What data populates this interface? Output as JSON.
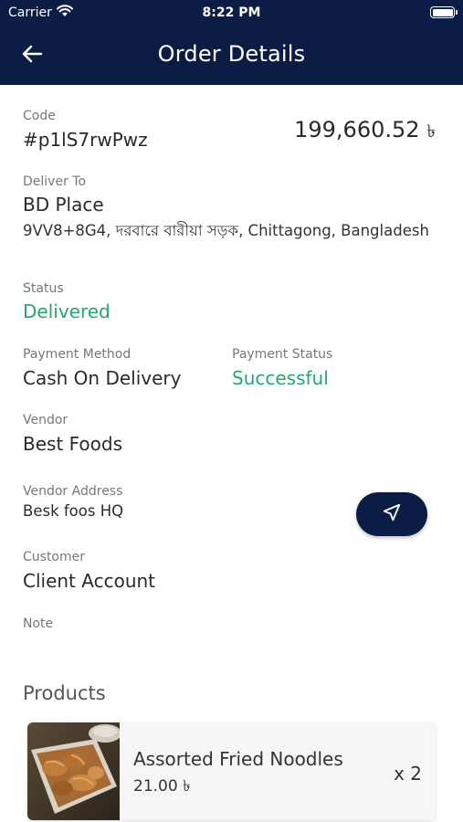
{
  "status_bar": {
    "carrier": "Carrier",
    "time": "8:22 PM"
  },
  "header": {
    "title": "Order Details"
  },
  "order": {
    "code_label": "Code",
    "code": "#p1lS7rwPwz",
    "total": "199,660.52",
    "currency": "৳",
    "deliver_label": "Deliver To",
    "deliver_name": "BD Place",
    "deliver_address": "9VV8+8G4, দরবারে বারীয়া সড়ক, Chittagong, Bangladesh",
    "status_label": "Status",
    "status": "Delivered",
    "payment_method_label": "Payment Method",
    "payment_method": "Cash On Delivery",
    "payment_status_label": "Payment Status",
    "payment_status": "Successful",
    "vendor_label": "Vendor",
    "vendor": "Best Foods",
    "vendor_address_label": "Vendor Address",
    "vendor_address": "Besk foos HQ",
    "customer_label": "Customer",
    "customer": "Client Account",
    "note_label": "Note"
  },
  "products": {
    "title": "Products",
    "items": [
      {
        "name": "Assorted Fried Noodles",
        "price": "21.00 ৳",
        "qty": "x 2"
      }
    ]
  },
  "colors": {
    "header_bg": "#0b1d45",
    "success": "#25a86d"
  },
  "icons": {
    "back": "arrow-left-icon",
    "navigate": "navigation-arrow-icon",
    "wifi": "wifi-icon",
    "battery": "battery-icon"
  }
}
